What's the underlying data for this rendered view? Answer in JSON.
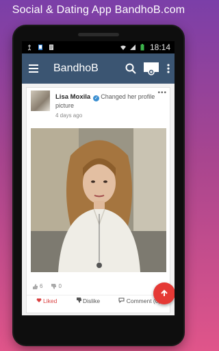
{
  "promo": {
    "title": "Social & Dating App BandhoB.com"
  },
  "statusbar": {
    "time": "18:14"
  },
  "appbar": {
    "title": "BandhoB"
  },
  "post": {
    "author": "Lisa Moxila",
    "action": "Changed her profile picture",
    "time_ago": "4 days ago",
    "likes_count": "6",
    "dislikes_count": "0"
  },
  "post_actions": {
    "like_label": "Liked",
    "dislike_label": "Dislike",
    "comment_label": "Comment (0)"
  },
  "colors": {
    "appbar": "#3b5572",
    "accent_red": "#e53935",
    "verified_blue": "#3b8fd1"
  }
}
